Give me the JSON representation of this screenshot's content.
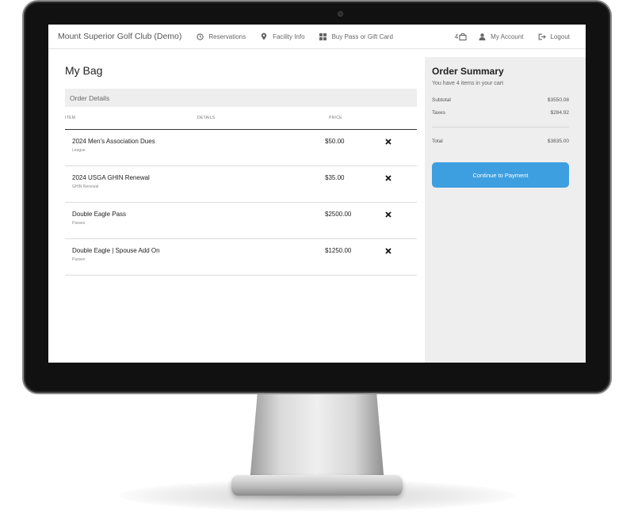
{
  "nav": {
    "brand": "Mount Superior Golf Club (Demo)",
    "items": [
      {
        "label": "Reservations",
        "icon": "clock-icon"
      },
      {
        "label": "Facility Info",
        "icon": "map-pin-icon"
      },
      {
        "label": "Buy Pass or Gift Card",
        "icon": "grid-icon"
      }
    ],
    "cart_count": "4",
    "account_label": "My Account",
    "logout_label": "Logout"
  },
  "main": {
    "title": "My Bag",
    "section_label": "Order Details",
    "columns": {
      "item": "ITEM",
      "details": "DETAILS",
      "price": "PRICE"
    },
    "items": [
      {
        "name": "2024 Men's Association Dues",
        "category": "League",
        "price": "$50.00"
      },
      {
        "name": "2024 USGA GHIN Renewal",
        "category": "GHIN Renewal",
        "price": "$35.00"
      },
      {
        "name": "Double Eagle Pass",
        "category": "Passes",
        "price": "$2500.00"
      },
      {
        "name": "Double Eagle | Spouse Add On",
        "category": "Passes",
        "price": "$1250.00"
      }
    ]
  },
  "summary": {
    "title": "Order Summary",
    "subtitle": "You have 4 items in your cart",
    "subtotal_label": "Subtotal",
    "subtotal_value": "$3550.08",
    "taxes_label": "Taxes",
    "taxes_value": "$284.92",
    "total_label": "Total",
    "total_value": "$3835.00",
    "button_label": "Continue to Payment"
  },
  "colors": {
    "accent": "#3d9fe0",
    "panel": "#eeeeee",
    "bezel": "#111111"
  }
}
